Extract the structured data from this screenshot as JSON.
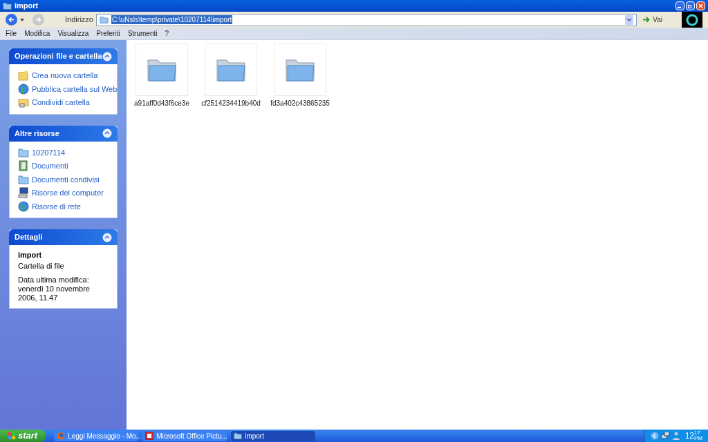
{
  "window": {
    "title": "import"
  },
  "address_bar": {
    "label": "Indirizzo",
    "value": "C:\\uNsIs\\temp\\private\\10207114\\import",
    "go_label": "Vai"
  },
  "menu": [
    "File",
    "Modifica",
    "Visualizza",
    "Preferiti",
    "Strumenti",
    "?"
  ],
  "sidebar": [
    {
      "title": "Operazioni file e cartella",
      "kind": "links",
      "items": [
        {
          "label": "Crea nuova cartella",
          "kind": "new-folder"
        },
        {
          "label": "Pubblica cartella sul Web",
          "kind": "globe"
        },
        {
          "label": "Condividi cartella",
          "kind": "share"
        }
      ]
    },
    {
      "title": "Altre risorse",
      "kind": "links",
      "items": [
        {
          "label": "10207114",
          "kind": "folder"
        },
        {
          "label": "Documenti",
          "kind": "documents"
        },
        {
          "label": "Documenti condivisi",
          "kind": "folder"
        },
        {
          "label": "Risorse del computer",
          "kind": "computer"
        },
        {
          "label": "Risorse di rete",
          "kind": "globe"
        }
      ]
    },
    {
      "title": "Dettagli",
      "kind": "details",
      "name": "import",
      "type": "Cartella di file",
      "modified": "Data ultima modifica: venerdì 10 novembre 2006, 11.47"
    }
  ],
  "files": [
    {
      "name": "a91aff0d43f6ce3e"
    },
    {
      "name": "cf2514234419b40d"
    },
    {
      "name": "fd3a402c43865235"
    }
  ],
  "taskbar": {
    "start": "start",
    "tasks": [
      {
        "label": "Leggi Messaggio - Mo...",
        "kind": "browser",
        "selected": false
      },
      {
        "label": "Microsoft Office Pictu...",
        "kind": "picture",
        "selected": false
      },
      {
        "label": "import",
        "kind": "folder",
        "selected": true
      }
    ],
    "clock": {
      "hour": "12",
      "minute": "17",
      "ampm": "PM"
    }
  }
}
